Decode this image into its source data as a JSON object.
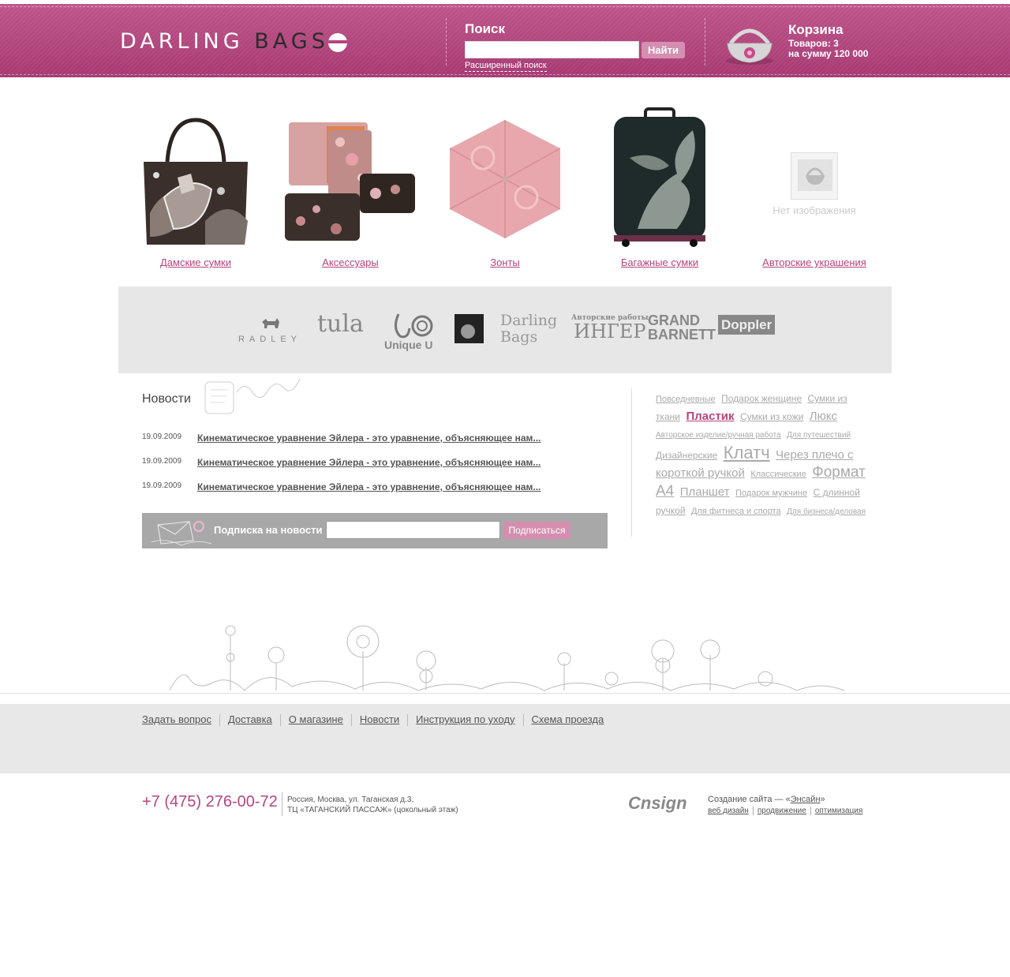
{
  "header": {
    "logo_light": "DARLING",
    "logo_dark": "BAGS",
    "search": {
      "title": "Поиск",
      "button": "Найти",
      "advanced": "Расширенный поиск",
      "value": ""
    },
    "cart": {
      "title": "Корзина",
      "count": "Товаров: 3",
      "sum": "на сумму 120 000"
    },
    "colors": {
      "brand": "#b4457f",
      "button": "#d48fb0"
    }
  },
  "categories": [
    {
      "label": "Дамские сумки",
      "icon": "handbag-image"
    },
    {
      "label": "Аксессуары",
      "icon": "wallets-image"
    },
    {
      "label": "Зонты",
      "icon": "umbrella-image"
    },
    {
      "label": "Багажные сумки",
      "icon": "suitcase-image"
    },
    {
      "label": "Авторские украшения",
      "icon": "no-image-placeholder",
      "no_image_text": "Нет изображения"
    }
  ],
  "brands": [
    {
      "name": "RADLEY"
    },
    {
      "name": "tula"
    },
    {
      "name": "Unique U"
    },
    {
      "name": "Darling Bags"
    },
    {
      "name_small": "Авторские работы",
      "name": "ИНГЕР"
    },
    {
      "name": "GRAND BARNETT"
    },
    {
      "name": "Doppler"
    }
  ],
  "news": {
    "title": "Новости",
    "items": [
      {
        "date": "19.09.2009",
        "text": "Кинематическое уравнение Эйлера - это уравнение, объясняющее нам..."
      },
      {
        "date": "19.09.2009",
        "text": "Кинематическое уравнение Эйлера - это уравнение, объясняющее нам..."
      },
      {
        "date": "19.09.2009",
        "text": "Кинематическое уравнение Эйлера - это уравнение, объясняющее нам..."
      }
    ],
    "subscribe": {
      "label": "Подписка на новости",
      "button": "Подписаться",
      "value": ""
    }
  },
  "tags": [
    {
      "text": "Повседневные",
      "size": 11
    },
    {
      "text": "Подарок женщине",
      "size": 12
    },
    {
      "text": "Сумки из ткани",
      "size": 12
    },
    {
      "text": "Пластик",
      "size": 15,
      "color": "#b4457f"
    },
    {
      "text": "Сумки из кожи",
      "size": 12
    },
    {
      "text": "Люкс",
      "size": 15
    },
    {
      "text": "Авторское изделие/ручная работа",
      "size": 10
    },
    {
      "text": "Для путешествий",
      "size": 10
    },
    {
      "text": "Дизайнерские",
      "size": 12
    },
    {
      "text": "Клатч",
      "size": 22
    },
    {
      "text": "Через плечо с короткой ручкой",
      "size": 15
    },
    {
      "text": "Классические",
      "size": 11
    },
    {
      "text": "Формат А4",
      "size": 19
    },
    {
      "text": "Планшет",
      "size": 15
    },
    {
      "text": "Подарок мужчине",
      "size": 11
    },
    {
      "text": "С длинной ручкой",
      "size": 12
    },
    {
      "text": "Для фитнеса и спорта",
      "size": 11
    },
    {
      "text": "Для бизнеса/деловая",
      "size": 10
    }
  ],
  "footer": {
    "nav": [
      "Задать вопрос",
      "Доставка",
      "О магазине",
      "Новости",
      "Инструкция по уходу",
      "Схема проезда"
    ],
    "phone": "+7 (475) 276-00-72",
    "address_line1": "Россия, Москва, ул. Таганская д.3,",
    "address_line2": "ТЦ «ТАГАНСКИЙ ПАССАЖ» (цокольный этаж)",
    "credit_logo": "Cnsign",
    "credit_prefix": "Создание сайта — «",
    "credit_name": "Энсайн",
    "credit_suffix": "»",
    "credit_links": [
      "веб дизайн",
      "продвижение",
      "оптимизация"
    ]
  }
}
